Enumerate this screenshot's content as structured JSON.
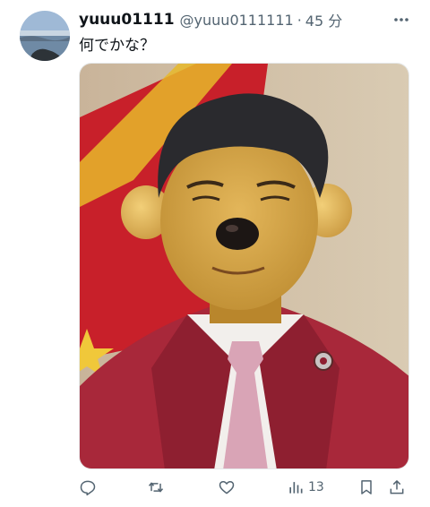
{
  "tweet": {
    "display_name": "yuuu01111",
    "handle": "@yuuu0111111",
    "separator": "·",
    "time": "45 分",
    "text": "何でかな？"
  },
  "actions": {
    "reply": {
      "icon": "reply-icon"
    },
    "retweet": {
      "icon": "retweet-icon"
    },
    "like": {
      "icon": "heart-icon"
    },
    "views": {
      "icon": "views-icon",
      "count": "13"
    },
    "bookmark": {
      "icon": "bookmark-icon"
    },
    "share": {
      "icon": "share-icon"
    }
  },
  "colors": {
    "text_primary": "#0f1419",
    "text_secondary": "#536471",
    "jacket_red": "#a8283a"
  }
}
